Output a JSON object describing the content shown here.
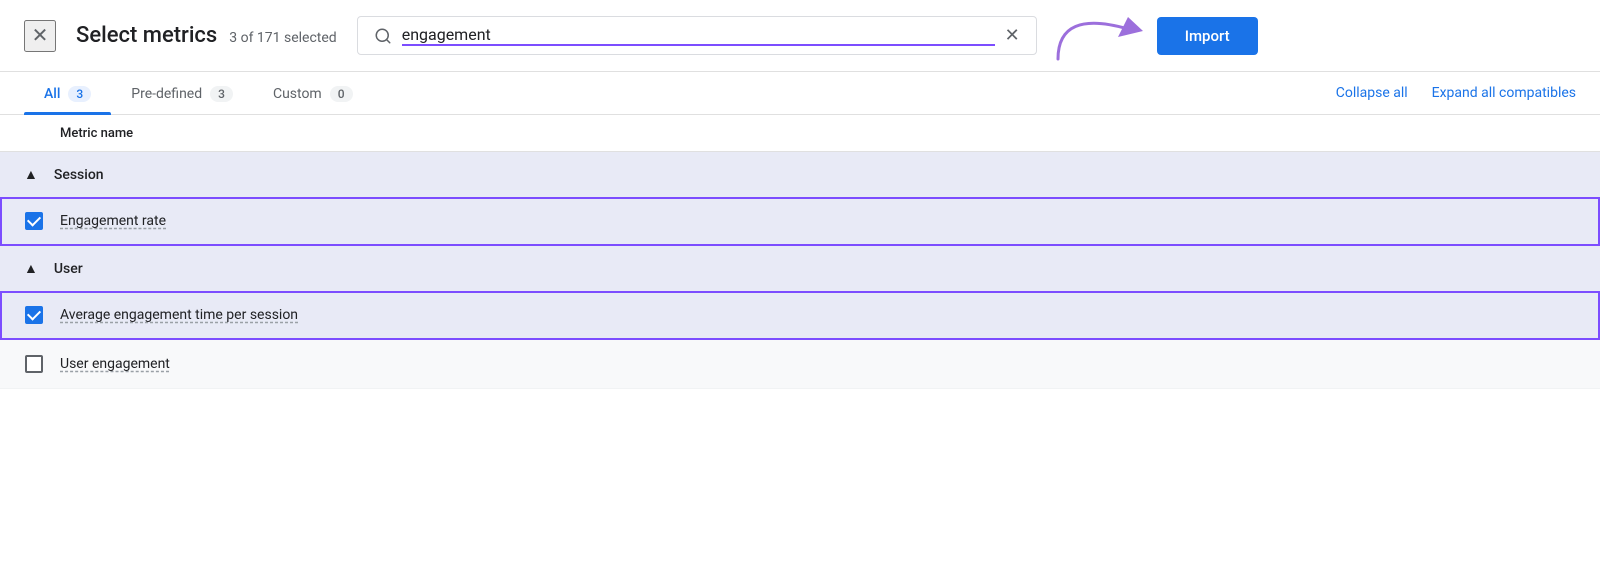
{
  "header": {
    "close_label": "✕",
    "title": "Select metrics",
    "subtitle": "3 of 171 selected",
    "import_label": "Import"
  },
  "search": {
    "placeholder": "engagement",
    "value": "engagement",
    "clear_icon": "✕"
  },
  "tabs": [
    {
      "id": "all",
      "label": "All",
      "badge": "3",
      "active": true
    },
    {
      "id": "predefined",
      "label": "Pre-defined",
      "badge": "3",
      "active": false
    },
    {
      "id": "custom",
      "label": "Custom",
      "badge": "0",
      "active": false
    }
  ],
  "tab_actions": {
    "collapse_label": "Collapse all",
    "expand_label": "Expand all compatibles"
  },
  "table": {
    "column_label": "Metric name"
  },
  "sections": [
    {
      "id": "session",
      "title": "Session",
      "expanded": true,
      "metrics": [
        {
          "id": "engagement_rate",
          "name": "Engagement rate",
          "checked": true,
          "highlighted": true
        }
      ]
    },
    {
      "id": "user",
      "title": "User",
      "expanded": true,
      "metrics": [
        {
          "id": "avg_engagement_time",
          "name": "Average engagement time per session",
          "checked": true,
          "highlighted": true
        },
        {
          "id": "user_engagement",
          "name": "User engagement",
          "checked": false,
          "highlighted": false
        }
      ]
    }
  ]
}
